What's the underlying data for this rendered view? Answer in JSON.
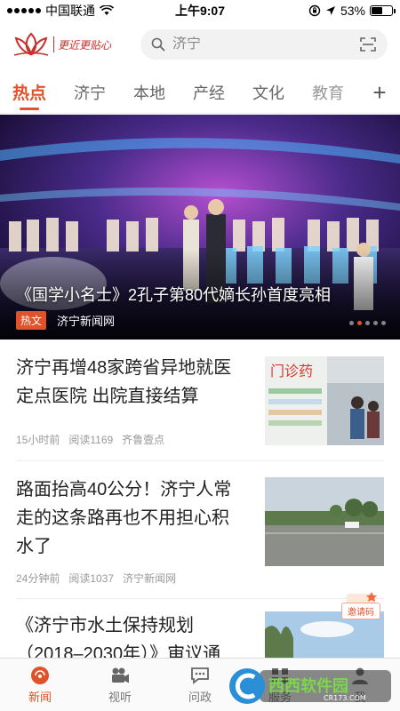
{
  "status_bar": {
    "carrier": "中国联通",
    "time": "上午9:07",
    "battery": "53%",
    "battery_level": 0.53
  },
  "header": {
    "logo_text": "更近更贴心",
    "search": {
      "value": "",
      "placeholder": "济宁"
    }
  },
  "tabs": [
    {
      "label": "热点",
      "active": true
    },
    {
      "label": "济宁"
    },
    {
      "label": "本地"
    },
    {
      "label": "产经"
    },
    {
      "label": "文化"
    },
    {
      "label": "教育"
    }
  ],
  "banner": {
    "title": "《国学小名士》2孔子第80代嫡长孙首度亮相",
    "tag": "热文",
    "source": "济宁新闻网",
    "slide_count": 5,
    "active_slide": 1
  },
  "news": [
    {
      "title": "济宁再增48家跨省异地就医定点医院 出院直接结算",
      "time": "15小时前",
      "reads": "阅读1169",
      "source": "齐鲁壹点"
    },
    {
      "title": "路面抬高40公分！济宁人常走的这条路再也不用担心积水了",
      "time": "24分钟前",
      "reads": "阅读1037",
      "source": "济宁新闻网"
    },
    {
      "title": "《济宁市水土保持规划（2018–2030年）》审议通",
      "time": "",
      "reads": "",
      "source": ""
    }
  ],
  "invite": {
    "label": "邀请码"
  },
  "bottom_nav": [
    {
      "label": "新闻",
      "icon": "news-icon",
      "active": true
    },
    {
      "label": "视听",
      "icon": "video-icon"
    },
    {
      "label": "问政",
      "icon": "chat-icon"
    },
    {
      "label": "服务",
      "icon": "service-icon"
    },
    {
      "label": "我",
      "icon": "user-icon"
    }
  ],
  "watermark": {
    "brand": "西西软件园",
    "domain": "CR173.COM"
  },
  "colors": {
    "accent": "#e0522a",
    "logo_red": "#c9302c"
  }
}
